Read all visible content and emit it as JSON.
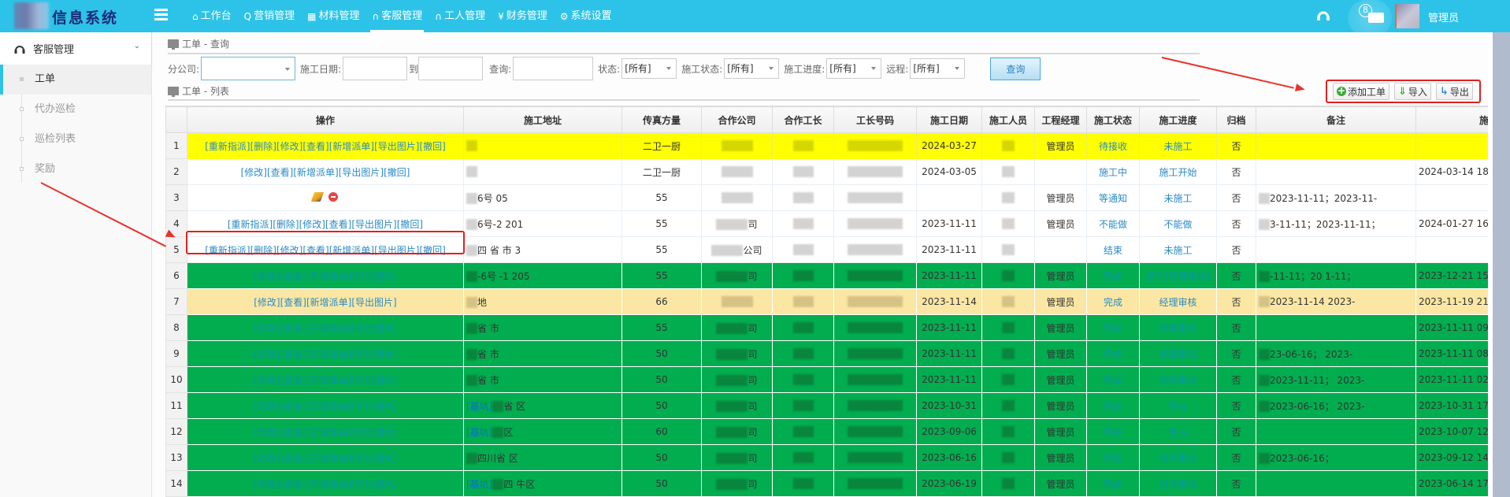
{
  "app": {
    "title": "信息系统",
    "user": "管理员",
    "message_count": "8"
  },
  "nav": [
    {
      "icon": "home-icon",
      "glyph": "⌂",
      "label": "工作台"
    },
    {
      "icon": "search-chat-icon",
      "glyph": "Q",
      "label": "营销管理"
    },
    {
      "icon": "grid-icon",
      "glyph": "▦",
      "label": "材料管理"
    },
    {
      "icon": "headset-icon",
      "glyph": "∩",
      "label": "客服管理",
      "active": true
    },
    {
      "icon": "headset-icon",
      "glyph": "∩",
      "label": "工人管理"
    },
    {
      "icon": "yen-icon",
      "glyph": "¥",
      "label": "财务管理"
    },
    {
      "icon": "gear-icon",
      "glyph": "⚙",
      "label": "系统设置"
    }
  ],
  "sidebar": {
    "group": "客服管理",
    "items": [
      {
        "label": "工单",
        "active": true
      },
      {
        "label": "代办巡检"
      },
      {
        "label": "巡检列表"
      },
      {
        "label": "奖励"
      }
    ]
  },
  "query_panel": {
    "title": "工单 - 查询",
    "company_label": "分公司:",
    "company_value": "",
    "date_label": "施工日期:",
    "date_from": "",
    "to_label": "到",
    "date_to": "",
    "search_label": "查询:",
    "search_value": "",
    "status_label": "状态:",
    "status_value": "[所有]",
    "build_status_label": "施工状态:",
    "build_status_value": "[所有]",
    "progress_label": "施工进度:",
    "progress_value": "[所有]",
    "remote_label": "远程:",
    "remote_value": "[所有]",
    "query_button": "查询"
  },
  "list_panel": {
    "title": "工单 - 列表",
    "add_button": "添加工单",
    "import_button": "导入",
    "export_button": "导出"
  },
  "table": {
    "columns": [
      "",
      "操作",
      "施工地址",
      "传真方量",
      "合作公司",
      "合作工长",
      "工长号码",
      "施工日期",
      "施工人员",
      "工程经理",
      "施工状态",
      "施工进度",
      "归档",
      "备注",
      "施工"
    ],
    "rows": [
      {
        "num": "1",
        "style": "yellow",
        "ops": [
          "[重新指派]",
          "[删除]",
          "[修改]",
          "[查看]",
          "[新增派单]",
          "[导出图片]",
          "[撤回]"
        ],
        "addr": "",
        "volume": "二卫一厨",
        "company": "",
        "foreman": "",
        "phone": "",
        "date": "2024-03-27",
        "worker": "",
        "manager": "管理员",
        "status": "待接收",
        "progress": "未施工",
        "archived": "否",
        "remark": "",
        "time": ""
      },
      {
        "num": "2",
        "style": "white",
        "ops": [
          "[修改]",
          "[查看]",
          "[新增派单]",
          "[导出图片]",
          "[撤回]"
        ],
        "addr": "",
        "volume": "二卫一厨",
        "company": "",
        "foreman": "",
        "phone": "",
        "date": "2024-03-05",
        "worker": "",
        "manager": "",
        "status": "施工中",
        "progress": "施工开始",
        "archived": "否",
        "remark": "",
        "time": "2024-03-14 18"
      },
      {
        "num": "3",
        "style": "white",
        "ops": [],
        "icons": true,
        "addr": "6号 05",
        "volume": "55",
        "company": "",
        "foreman": "",
        "phone": "",
        "date": "",
        "worker": "",
        "manager": "管理员",
        "status": "等通知",
        "progress": "未施工",
        "archived": "否",
        "remark": "2023-11-11；2023-11-",
        "time": ""
      },
      {
        "num": "4",
        "style": "white",
        "ops": [
          "[重新指派]",
          "[删除]",
          "[修改]",
          "[查看]",
          "[导出图片]",
          "[撤回]"
        ],
        "addr": "6号-2 201",
        "volume": "55",
        "company": "司",
        "foreman": "",
        "phone": "",
        "date": "2023-11-11",
        "worker": "",
        "manager": "管理员",
        "status": "不能做",
        "progress": "不能做",
        "archived": "否",
        "remark": "3-11-11；2023-11-11；",
        "time": "2024-01-27 16"
      },
      {
        "num": "5",
        "style": "white",
        "ops": [
          "[重新指派]",
          "[删除]",
          "[修改]",
          "[查看]",
          "[新增派单]",
          "[导出图片]",
          "[撤回]"
        ],
        "addr": "四 省 市 3",
        "volume": "55",
        "company": "公司",
        "foreman": "",
        "phone": "",
        "date": "2023-11-11",
        "worker": "",
        "manager": "",
        "status": "结束",
        "progress": "未施工",
        "archived": "否",
        "remark": "",
        "time": ""
      },
      {
        "num": "6",
        "style": "green",
        "ops": [
          "[修改]",
          "[查看]",
          "[新增派单]",
          "[导出图片]"
        ],
        "addr": "-6号 -1 205",
        "volume": "55",
        "company": "司",
        "foreman": "",
        "phone": "",
        "date": "2023-11-11",
        "worker": "",
        "manager": "管理员",
        "status": "完成",
        "progress": "返工[经理审核]",
        "archived": "否",
        "remark": "-11-11；20 1-11；",
        "time": "2023-12-21 15"
      },
      {
        "num": "7",
        "style": "beige",
        "ops": [
          "[修改]",
          "[查看]",
          "[新增派单]",
          "[导出图片]"
        ],
        "addr": "地",
        "volume": "66",
        "company": "",
        "foreman": "",
        "phone": "",
        "date": "2023-11-14",
        "worker": "",
        "manager": "管理员",
        "status": "完成",
        "progress": "经理审核",
        "archived": "否",
        "remark": "2023-11-14 2023-",
        "time": "2023-11-19 21"
      },
      {
        "num": "8",
        "style": "green",
        "ops": [
          "[修改]",
          "[查看]",
          "[新增派单]",
          "[导出图片]"
        ],
        "addr": "省 市",
        "volume": "55",
        "company": "司",
        "foreman": "",
        "phone": "",
        "date": "2023-11-11",
        "worker": "",
        "manager": "管理员",
        "status": "完成",
        "progress": "经理审核",
        "archived": "否",
        "remark": "",
        "time": "2023-11-11 09"
      },
      {
        "num": "9",
        "style": "green",
        "ops": [
          "[修改]",
          "[查看]",
          "[新增派单]",
          "[导出图片]"
        ],
        "addr": "省 市",
        "volume": "50",
        "company": "司",
        "foreman": "",
        "phone": "",
        "date": "2023-11-11",
        "worker": "",
        "manager": "管理员",
        "status": "完成",
        "progress": "经理审核",
        "archived": "否",
        "remark": "23-06-16； 2023-",
        "time": "2023-11-11 08"
      },
      {
        "num": "10",
        "style": "green",
        "ops": [
          "[修改]",
          "[查看]",
          "[新增派单]",
          "[导出图片]"
        ],
        "addr": "省 市",
        "volume": "50",
        "company": "司",
        "foreman": "",
        "phone": "",
        "date": "2023-11-11",
        "worker": "",
        "manager": "管理员",
        "status": "完成",
        "progress": "绩效审核",
        "archived": "否",
        "remark": "2023-11-11； 2023-",
        "time": "2023-11-11 02"
      },
      {
        "num": "11",
        "style": "green",
        "ops": [
          "[修改]",
          "[查看]",
          "[新增派单]",
          "[导出图片]"
        ],
        "addr_tag": "[基坑]",
        "addr": "省 区",
        "volume": "50",
        "company": "司",
        "foreman": "",
        "phone": "",
        "date": "2023-10-31",
        "worker": "",
        "manager": "管理员",
        "status": "完成",
        "progress": "完成",
        "archived": "否",
        "remark": "2023-06-16； 2023-",
        "time": "2023-10-31 17"
      },
      {
        "num": "12",
        "style": "green",
        "ops": [
          "[修改]",
          "[查看]",
          "[新增派单]",
          "[导出图片]"
        ],
        "addr_tag": "[基坑]",
        "addr": "区",
        "volume": "60",
        "company": "司",
        "foreman": "",
        "phone": "",
        "date": "2023-09-06",
        "worker": "",
        "manager": "管理员",
        "status": "完成",
        "progress": "完成",
        "archived": "否",
        "remark": "",
        "time": "2023-10-07 12"
      },
      {
        "num": "13",
        "style": "green",
        "ops": [
          "[修改]",
          "[查看]",
          "[新增派单]",
          "[导出图片]"
        ],
        "addr": "四川省 区",
        "volume": "50",
        "company": "司",
        "foreman": "",
        "phone": "",
        "date": "2023-06-16",
        "worker": "",
        "manager": "管理员",
        "status": "完成",
        "progress": "财务审核",
        "archived": "否",
        "remark": "2023-06-16；",
        "time": "2023-09-12 14"
      },
      {
        "num": "14",
        "style": "green",
        "ops": [
          "[修改]",
          "[查看]",
          "[新增派单]",
          "[导出图片]"
        ],
        "addr_tag": "[基坑]",
        "addr": "四 牛区",
        "volume": "50",
        "company": "司",
        "foreman": "",
        "phone": "",
        "date": "2023-06-19",
        "worker": "",
        "manager": "管理员",
        "status": "完成",
        "progress": "财务审核",
        "archived": "否",
        "remark": "",
        "time": "2023-06-14 17"
      }
    ]
  },
  "colors": {
    "topbar": "#2dc3e8",
    "row_yellow": "#ffff00",
    "row_green": "#01ad4f",
    "row_beige": "#fbe7a3",
    "link": "#2a8ac6",
    "annotation": "#e02020"
  }
}
